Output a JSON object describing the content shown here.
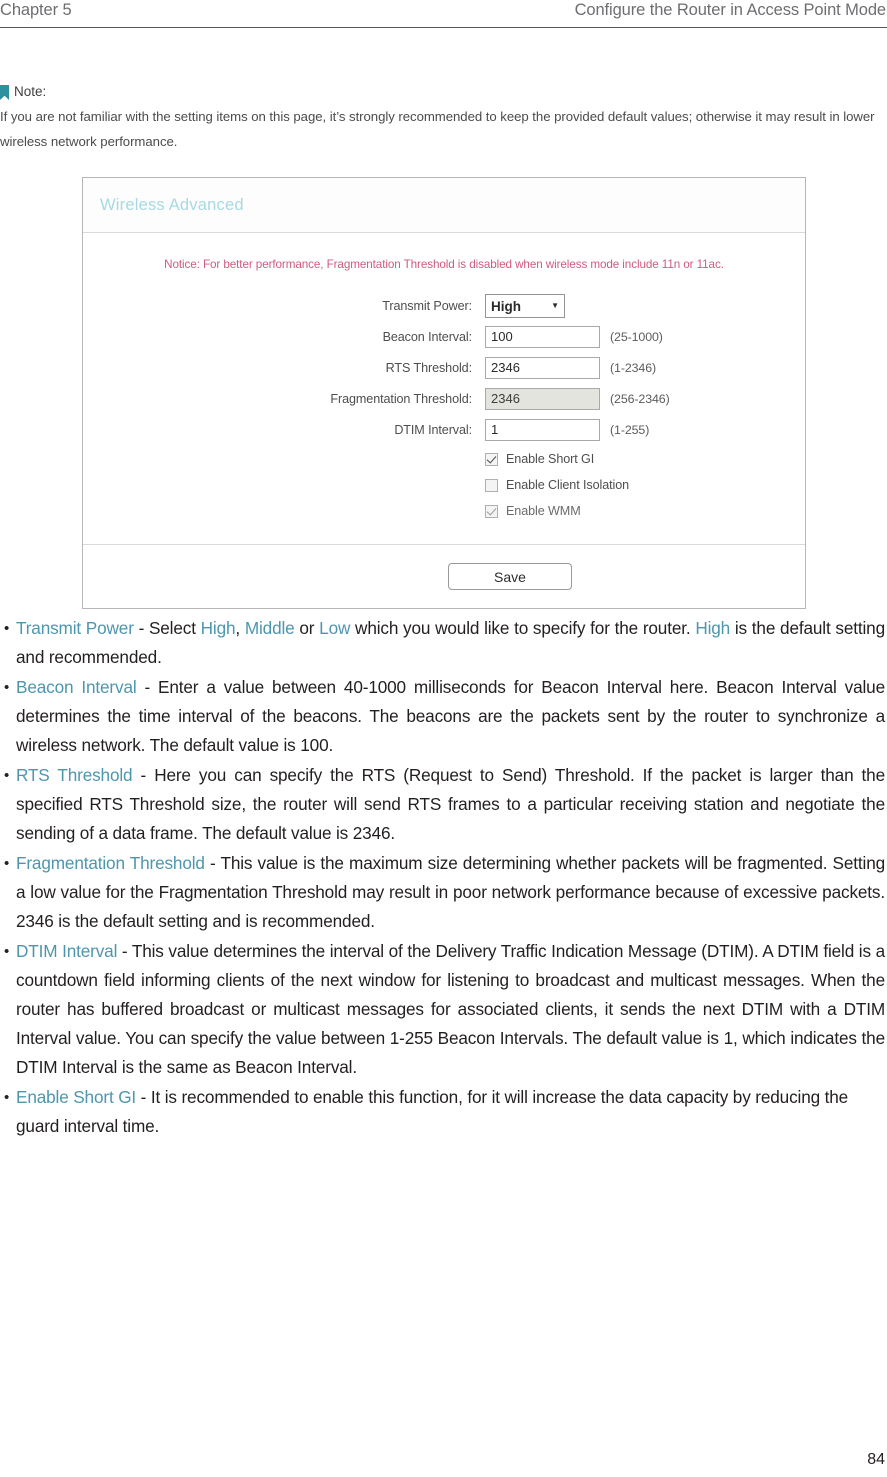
{
  "header": {
    "chapter": "Chapter 5",
    "section": "Configure the Router in Access Point Mode"
  },
  "note": {
    "title": "Note:",
    "body": "If you are not familiar with the setting items on this page, it’s strongly recommended to keep the provided default values; otherwise it may result in lower wireless network performance."
  },
  "router_ui": {
    "panel_title": "Wireless Advanced",
    "notice": "Notice: For better performance, Fragmentation Threshold is disabled when wireless mode include 11n or 11ac.",
    "fields": [
      {
        "label": "Transmit Power:",
        "value": "High",
        "hint": "",
        "type": "select",
        "disabled": false
      },
      {
        "label": "Beacon Interval:",
        "value": "100",
        "hint": "(25-1000)",
        "type": "text",
        "disabled": false
      },
      {
        "label": "RTS Threshold:",
        "value": "2346",
        "hint": "(1-2346)",
        "type": "text",
        "disabled": false
      },
      {
        "label": "Fragmentation Threshold:",
        "value": "2346",
        "hint": "(256-2346)",
        "type": "text",
        "disabled": true
      },
      {
        "label": "DTIM Interval:",
        "value": "1",
        "hint": "(1-255)",
        "type": "text",
        "disabled": false
      }
    ],
    "checkboxes": [
      {
        "label": "Enable Short GI",
        "checked": true,
        "dim": false
      },
      {
        "label": "Enable Client Isolation",
        "checked": false,
        "dim": false
      },
      {
        "label": "Enable WMM",
        "checked": true,
        "dim": true
      }
    ],
    "save_label": "Save",
    "select_options": [
      "High",
      "Middle",
      "Low"
    ],
    "caret_glyph": "▼",
    "accent_title_color": "#a8d9e2",
    "notice_color": "#d15a7e"
  },
  "bullets": [
    {
      "bullet_glyph": "•",
      "segments": [
        {
          "t": "Transmit Power",
          "term": true
        },
        {
          "t": " - Select ",
          "term": false
        },
        {
          "t": "High",
          "term": true
        },
        {
          "t": ", ",
          "term": false
        },
        {
          "t": "Middle",
          "term": true
        },
        {
          "t": " or ",
          "term": false
        },
        {
          "t": "Low",
          "term": true
        },
        {
          "t": " which you would like to specify for the router. ",
          "term": false
        },
        {
          "t": "High",
          "term": true
        },
        {
          "t": " is the default setting and recommended.",
          "term": false
        }
      ]
    },
    {
      "bullet_glyph": "•",
      "segments": [
        {
          "t": "Beacon Interval",
          "term": true
        },
        {
          "t": " - Enter a value between 40-1000 milliseconds for Beacon Interval here. Beacon Interval value determines the time interval of the beacons. The beacons are the packets sent by the router to synchronize a wireless network. The default value is 100.",
          "term": false
        }
      ]
    },
    {
      "bullet_glyph": "•",
      "segments": [
        {
          "t": "RTS Threshold",
          "term": true
        },
        {
          "t": " - Here you can specify the RTS (Request to Send) Threshold. If the packet is larger than the specified RTS Threshold size, the router will send RTS frames to a particular receiving station and negotiate the sending of a data frame. The default value is 2346.",
          "term": false
        }
      ]
    },
    {
      "bullet_glyph": "•",
      "segments": [
        {
          "t": "Fragmentation Threshold",
          "term": true
        },
        {
          "t": " - This value is the maximum size determining whether packets will be fragmented. Setting a low value for the Fragmentation Threshold may result in poor network performance because of excessive packets. 2346 is the default setting and is recommended.",
          "term": false
        }
      ]
    },
    {
      "bullet_glyph": "•",
      "segments": [
        {
          "t": "DTIM Interval",
          "term": true
        },
        {
          "t": " - This value determines the interval of the Delivery Traffic Indication Message (DTIM). A DTIM field is a countdown field informing clients of the next window for listening to broadcast and multicast messages. When the router has buffered broadcast or multicast messages for associated clients, it sends the next DTIM with a DTIM Interval value. You can specify the value between 1-255 Beacon Intervals. The default value is 1, which indicates the DTIM Interval is the same as Beacon Interval.",
          "term": false
        }
      ]
    },
    {
      "bullet_glyph": "•",
      "segments": [
        {
          "t": "Enable Short GI",
          "term": true
        },
        {
          "t": " - It is recommended to enable this function, for it will increase the data capacity by reducing the guard interval time.",
          "term": false
        }
      ]
    }
  ],
  "page_number": "84"
}
